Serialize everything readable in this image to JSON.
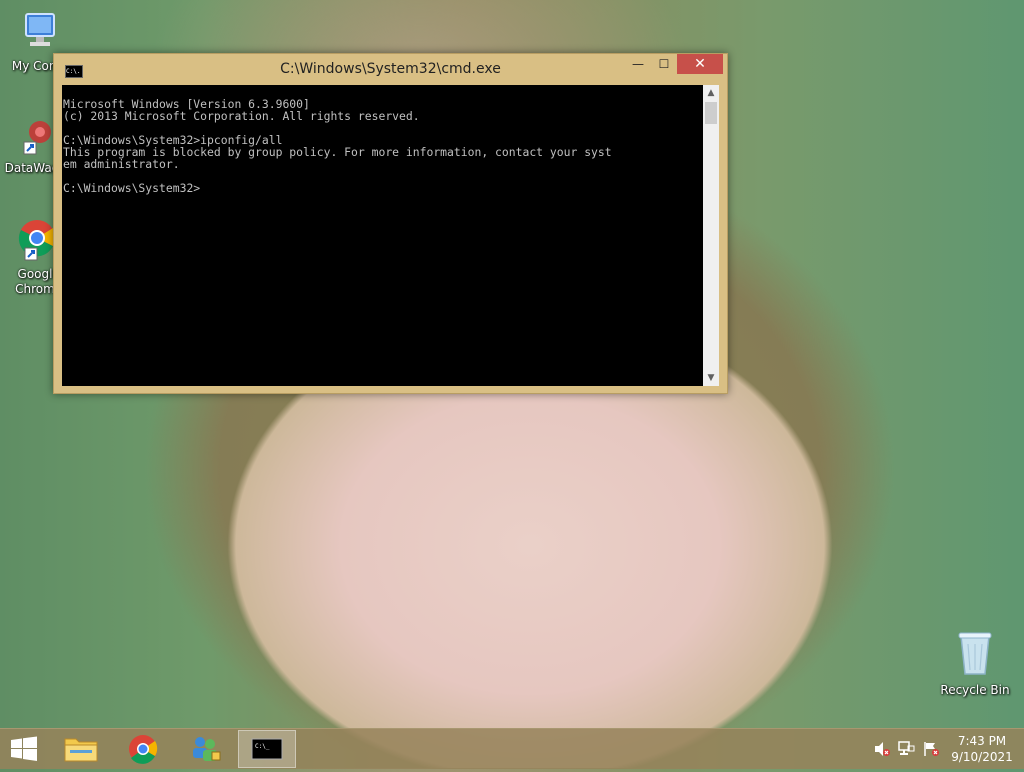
{
  "desktop": {
    "icons": [
      {
        "name": "my-computer",
        "label": "My Comp"
      },
      {
        "name": "datawag",
        "label": "DataWag"
      },
      {
        "name": "chrome",
        "label_line1": "Googl",
        "label_line2": "Chrom"
      },
      {
        "name": "recycle-bin",
        "label": "Recycle Bin"
      }
    ]
  },
  "window": {
    "title": "C:\\Windows\\System32\\cmd.exe",
    "icon_text": "C:\\.",
    "minimize": "—",
    "maximize": "☐",
    "close": "✕",
    "console_lines": [
      "Microsoft Windows [Version 6.3.9600]",
      "(c) 2013 Microsoft Corporation. All rights reserved.",
      "",
      "C:\\Windows\\System32>ipconfig/all",
      "This program is blocked by group policy. For more information, contact your syst",
      "em administrator.",
      "",
      "C:\\Windows\\System32>"
    ]
  },
  "taskbar": {
    "time": "7:43 PM",
    "date": "9/10/2021",
    "items": [
      "start",
      "file-explorer",
      "chrome",
      "network-app",
      "cmd"
    ]
  }
}
